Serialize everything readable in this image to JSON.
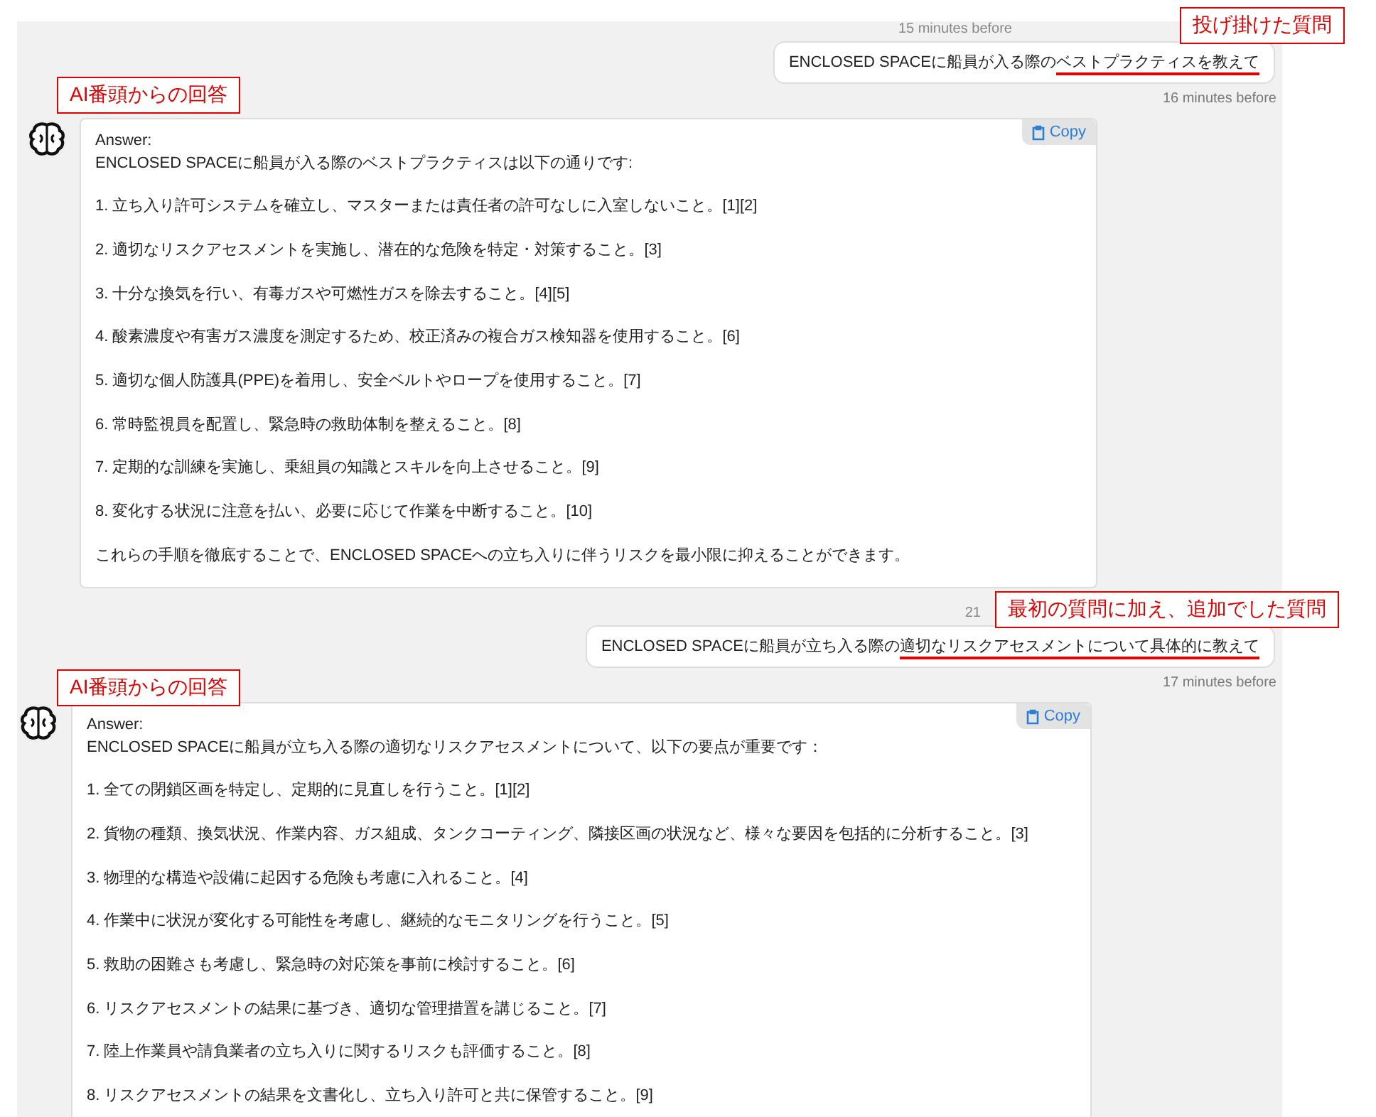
{
  "conversations": [
    {
      "time_above": "15 minutes before",
      "question": [
        {
          "text": "ENCLOSED SPACEに船員が入る際の",
          "underlined": false
        },
        {
          "text": "ベストプラクティスを教えて",
          "underlined": true
        }
      ],
      "question_time": "16 minutes before",
      "answer": {
        "copy_label": "Copy",
        "heading": "Answer:",
        "intro": "ENCLOSED SPACEに船員が入る際のベストプラクティスは以下の通りです:",
        "items": [
          "1. 立ち入り許可システムを確立し、マスターまたは責任者の許可なしに入室しないこと。[1][2]",
          "2. 適切なリスクアセスメントを実施し、潜在的な危険を特定・対策すること。[3]",
          "3. 十分な換気を行い、有毒ガスや可燃性ガスを除去すること。[4][5]",
          "4. 酸素濃度や有害ガス濃度を測定するため、校正済みの複合ガス検知器を使用すること。[6]",
          "5. 適切な個人防護具(PPE)を着用し、安全ベルトやロープを使用すること。[7]",
          "6. 常時監視員を配置し、緊急時の救助体制を整えること。[8]",
          "7. 定期的な訓練を実施し、乗組員の知識とスキルを向上させること。[9]",
          "8. 変化する状況に注意を払い、必要に応じて作業を中断すること。[10]"
        ],
        "conclusion": "これらの手順を徹底することで、ENCLOSED SPACEへの立ち入りに伴うリスクを最小限に抑えることができます。"
      }
    },
    {
      "time_above": "21",
      "question": [
        {
          "text": "ENCLOSED SPACEに船員が立ち入る際の",
          "underlined": false
        },
        {
          "text": "適切なリスクアセスメントについて具体的に教えて",
          "underlined": true
        }
      ],
      "question_time": "17 minutes before",
      "answer": {
        "copy_label": "Copy",
        "heading": "Answer:",
        "intro": "ENCLOSED SPACEに船員が立ち入る際の適切なリスクアセスメントについて、以下の要点が重要です：",
        "items": [
          "1. 全ての閉鎖区画を特定し、定期的に見直しを行うこと。[1][2]",
          "2. 貨物の種類、換気状況、作業内容、ガス組成、タンクコーティング、隣接区画の状況など、様々な要因を包括的に分析すること。[3]",
          "3. 物理的な構造や設備に起因する危険も考慮に入れること。[4]",
          "4. 作業中に状況が変化する可能性を考慮し、継続的なモニタリングを行うこと。[5]",
          "5. 救助の困難さも考慮し、緊急時の対応策を事前に検討すること。[6]",
          "6. リスクアセスメントの結果に基づき、適切な管理措置を講じること。[7]",
          "7. 陸上作業員や請負業者の立ち入りに関するリスクも評価すること。[8]",
          "8. リスクアセスメントの結果を文書化し、立ち入り許可と共に保管すること。[9]"
        ]
      }
    }
  ],
  "annotations": [
    {
      "text": "投げ掛けた質問"
    },
    {
      "text": "AI番頭からの回答"
    },
    {
      "text": "最初の質問に加え、追加でした質問"
    },
    {
      "text": "AI番頭からの回答"
    }
  ]
}
